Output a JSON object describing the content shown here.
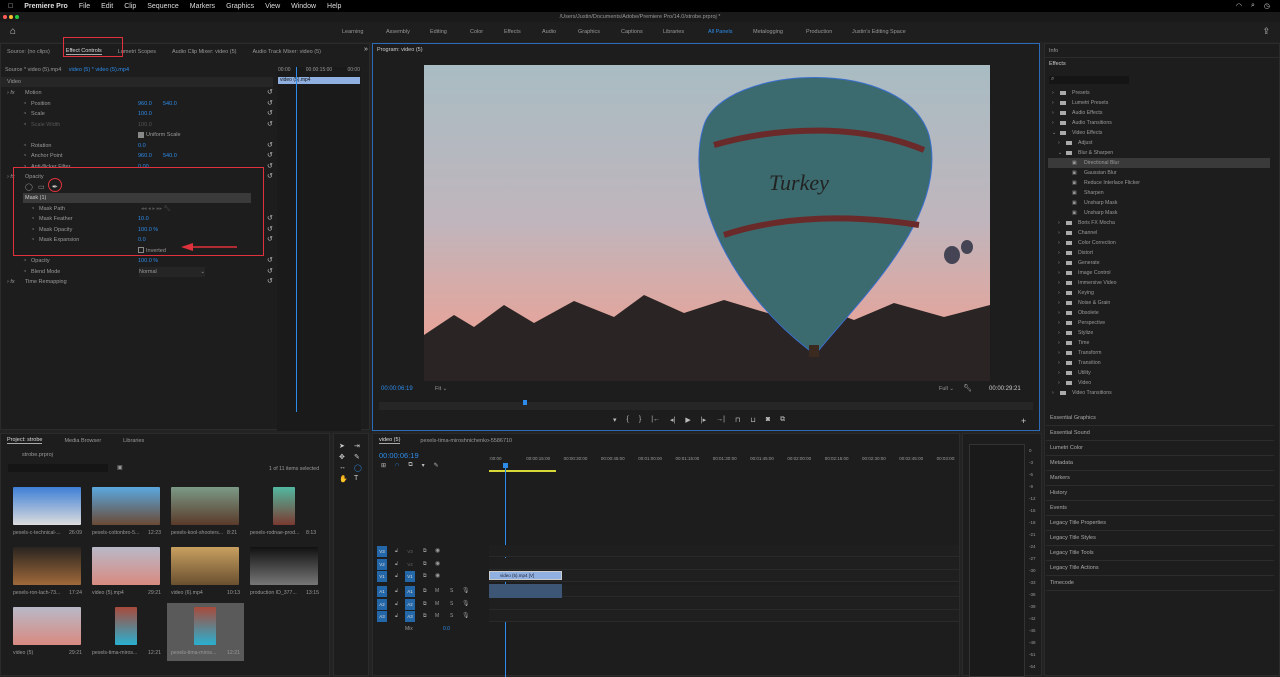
{
  "menubar": {
    "app": "Premiere Pro",
    "items": [
      "File",
      "Edit",
      "Clip",
      "Sequence",
      "Markers",
      "Graphics",
      "View",
      "Window",
      "Help"
    ]
  },
  "title": "/Users/Justin/Documents/Adobe/Premiere Pro/14.0/strobe.prproj *",
  "workspaces": [
    "Learning",
    "Assembly",
    "Editing",
    "Color",
    "Effects",
    "Audio",
    "Graphics",
    "Captions",
    "Libraries",
    "All Panels",
    "Metalogging",
    "Production",
    "Justin's Editing Space"
  ],
  "active_workspace": "All Panels",
  "left_tabs": [
    "Source: (no clips)",
    "Effect Controls",
    "Lumetri Scopes",
    "Audio Clip Mixer: video (5)",
    "Audio Track Mixer: video (5)"
  ],
  "effect_controls": {
    "source": "Source * video (5).mp4",
    "sequence": "video (5) * video (5).mp4",
    "section": "Video",
    "mini_ruler": [
      "00:00",
      "00:00:15:00",
      "00:00"
    ],
    "mini_clip": "video (5).mp4",
    "rows": [
      {
        "label": "Motion",
        "kind": "fx"
      },
      {
        "label": "Position",
        "v1": "960.0",
        "v2": "540.0"
      },
      {
        "label": "Scale",
        "v1": "100.0"
      },
      {
        "label": "Scale Width",
        "v1": "100.0",
        "dim": true
      },
      {
        "label": "",
        "check": "Uniform Scale",
        "checked": true
      },
      {
        "label": "Rotation",
        "v1": "0.0"
      },
      {
        "label": "Anchor Point",
        "v1": "960.0",
        "v2": "540.0"
      },
      {
        "label": "Anti-flicker Filter",
        "v1": "0.00"
      },
      {
        "label": "Opacity",
        "kind": "fx"
      },
      {
        "label": "",
        "kind": "masktools"
      },
      {
        "label": "Mask (1)",
        "kind": "mask"
      },
      {
        "label": "Mask Path",
        "kind": "maskpath"
      },
      {
        "label": "Mask Feather",
        "v1": "10.0"
      },
      {
        "label": "Mask Opacity",
        "v1": "100.0 %"
      },
      {
        "label": "Mask Expansion",
        "v1": "0.0"
      },
      {
        "label": "",
        "check": "Inverted",
        "checked": false
      },
      {
        "label": "Opacity",
        "v1": "100.0 %"
      },
      {
        "label": "Blend Mode",
        "select": "Normal"
      },
      {
        "label": "Time Remapping",
        "kind": "fx"
      }
    ]
  },
  "program": {
    "title": "Program: video (5)",
    "timecode": "00:00:06:19",
    "fit": "Fit",
    "quality": "Full",
    "duration": "00:00:29:21",
    "playhead_fraction": 0.22
  },
  "right": {
    "info": "Info",
    "effects_title": "Effects",
    "tree": [
      {
        "label": "Presets",
        "level": 0
      },
      {
        "label": "Lumetri Presets",
        "level": 0
      },
      {
        "label": "Audio Effects",
        "level": 0
      },
      {
        "label": "Audio Transitions",
        "level": 0
      },
      {
        "label": "Video Effects",
        "level": 0,
        "open": true
      },
      {
        "label": "Adjust",
        "level": 1
      },
      {
        "label": "Blur & Sharpen",
        "level": 1,
        "open": true
      },
      {
        "label": "Directional Blur",
        "level": 2,
        "selected": true
      },
      {
        "label": "Gaussian Blur",
        "level": 2
      },
      {
        "label": "Reduce Interlace Flicker",
        "level": 2
      },
      {
        "label": "Sharpen",
        "level": 2
      },
      {
        "label": "Unsharp Mask",
        "level": 2
      },
      {
        "label": "Unsharp Mask",
        "level": 2
      },
      {
        "label": "Boris FX Mocha",
        "level": 1
      },
      {
        "label": "Channel",
        "level": 1
      },
      {
        "label": "Color Correction",
        "level": 1
      },
      {
        "label": "Distort",
        "level": 1
      },
      {
        "label": "Generate",
        "level": 1
      },
      {
        "label": "Image Control",
        "level": 1
      },
      {
        "label": "Immersive Video",
        "level": 1
      },
      {
        "label": "Keying",
        "level": 1
      },
      {
        "label": "Noise & Grain",
        "level": 1
      },
      {
        "label": "Obsolete",
        "level": 1
      },
      {
        "label": "Perspective",
        "level": 1
      },
      {
        "label": "Stylize",
        "level": 1
      },
      {
        "label": "Time",
        "level": 1
      },
      {
        "label": "Transform",
        "level": 1
      },
      {
        "label": "Transition",
        "level": 1
      },
      {
        "label": "Utility",
        "level": 1
      },
      {
        "label": "Video",
        "level": 1
      },
      {
        "label": "Video Transitions",
        "level": 0
      }
    ],
    "panels": [
      "Essential Graphics",
      "Essential Sound",
      "Lumetri Color",
      "Metadata",
      "Markers",
      "History",
      "Events",
      "Legacy Title Properties",
      "Legacy Title Styles",
      "Legacy Title Tools",
      "Legacy Title Actions",
      "Timecode"
    ]
  },
  "project": {
    "tabs": [
      "Project: strobe",
      "Media Browser",
      "Libraries"
    ],
    "file": "strobe.prproj",
    "selection": "1 of 11 items selected",
    "items": [
      {
        "name": "pexels-c-technical-...",
        "dur": "26:09",
        "c1": "#3d7fd6",
        "c2": "#ddd"
      },
      {
        "name": "pexels-cottonbro-5...",
        "dur": "12:23",
        "c1": "#5aa8e0",
        "c2": "#6a4a35"
      },
      {
        "name": "pexels-kool-shooters...",
        "dur": "8:21",
        "c1": "#7b9a86",
        "c2": "#5a3a2a"
      },
      {
        "name": "pexels-rodnae-prod...",
        "dur": "8:13",
        "c1": "#52b8a0",
        "c2": "#7a3a30",
        "narrow": true
      },
      {
        "name": "pexels-ron-lach-73...",
        "dur": "17:24",
        "c1": "#2a2420",
        "c2": "#a06a3a"
      },
      {
        "name": "video (5).mp4",
        "dur": "29:21",
        "c1": "#b9b9c8",
        "c2": "#d88a80"
      },
      {
        "name": "video (6).mp4",
        "dur": "10:13",
        "c1": "#c8a060",
        "c2": "#6a5030"
      },
      {
        "name": "production ID_377...",
        "dur": "13:15",
        "c1": "#111",
        "c2": "#777"
      },
      {
        "name": "video (5)",
        "dur": "29:21",
        "c1": "#b9b9c8",
        "c2": "#d88a80"
      },
      {
        "name": "pexels-tima-miros...",
        "dur": "12:21",
        "c1": "#a84a3a",
        "c2": "#2ab0d0",
        "narrow": true
      },
      {
        "name": "pexels-tima-miros...",
        "dur": "12:21",
        "c1": "#a84a3a",
        "c2": "#2ab0d0",
        "narrow": true,
        "selected": true
      }
    ]
  },
  "timeline": {
    "tabs": [
      "video (5)",
      "pexels-tima-miroshnichenko-5586710"
    ],
    "timecode": "00:00:06:19",
    "ruler": [
      ":00:00",
      "00:00:15:00",
      "00:00:30:00",
      "00:00:45:00",
      "00:01:00:00",
      "00:01:15:00",
      "00:01:30:00",
      "00:01:45:00",
      "00:02:00:00",
      "00:02:15:00",
      "00:02:30:00",
      "00:02:45:00",
      "00:03:00:"
    ],
    "video_tracks": [
      {
        "src": "V3",
        "name": "V3"
      },
      {
        "src": "V2",
        "name": "V2"
      },
      {
        "src": "V1",
        "name": "V1"
      }
    ],
    "audio_tracks": [
      {
        "src": "A1",
        "name": "A1"
      },
      {
        "src": "A2",
        "name": "A2"
      },
      {
        "src": "A3",
        "name": "A3"
      }
    ],
    "mix_label": "Mix",
    "mix_value": "0.0",
    "clip": "video (5).mp4 [V]",
    "m": "M",
    "s": "S"
  },
  "meter": {
    "labels": [
      "0",
      "-3",
      "-6",
      "-9",
      "-12",
      "-15",
      "-18",
      "-21",
      "-24",
      "-27",
      "-30",
      "-33",
      "-36",
      "-39",
      "-42",
      "-45",
      "-48",
      "-51",
      "-54"
    ]
  },
  "colors": {
    "accent": "#2d8ceb",
    "highlight": "#e0323c",
    "clip": "#8fb0e0"
  }
}
